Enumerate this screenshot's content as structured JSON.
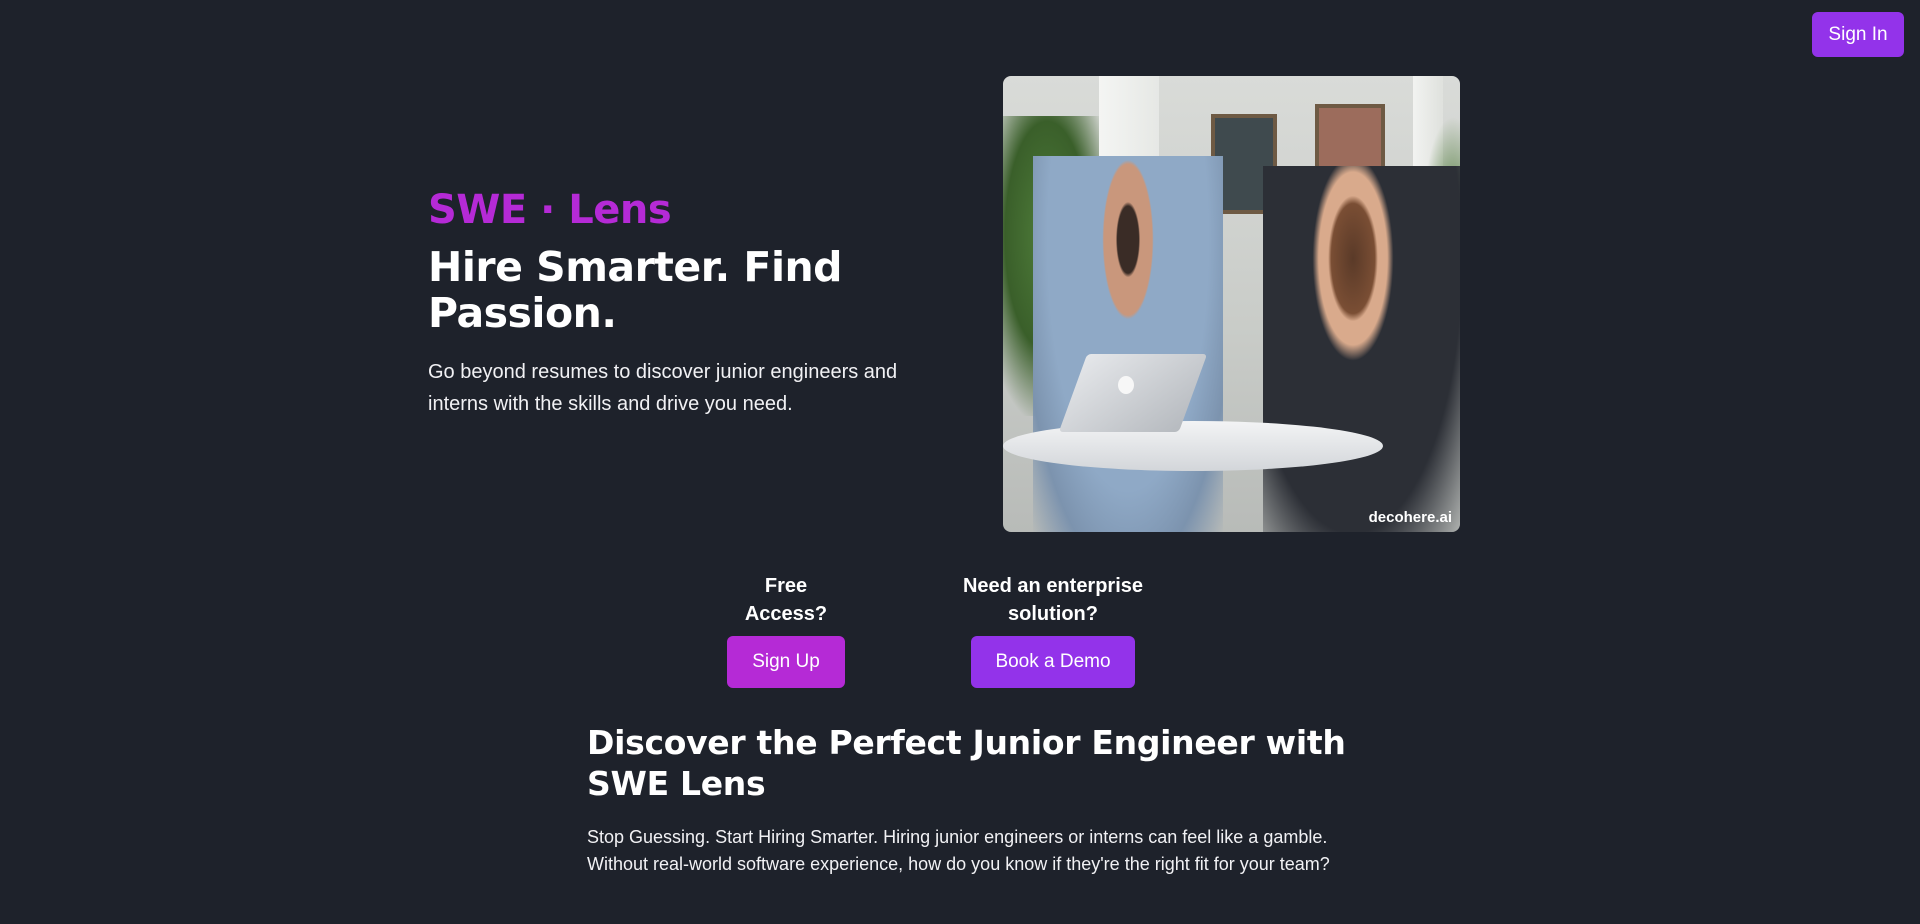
{
  "header": {
    "sign_in_label": "Sign In"
  },
  "hero": {
    "brand": "SWE · Lens",
    "headline": "Hire Smarter. Find Passion.",
    "subline": "Go beyond resumes to discover junior engineers and interns with the skills and drive you need.",
    "image_watermark": "decohere.ai"
  },
  "cta": {
    "free": {
      "label": "Free Access?",
      "button": "Sign Up"
    },
    "enterprise": {
      "label": "Need an enterprise solution?",
      "button": "Book a Demo"
    }
  },
  "discover": {
    "title": "Discover the Perfect Junior Engineer with SWE Lens",
    "body": "Stop Guessing. Start Hiring Smarter. Hiring junior engineers or interns can feel like a gamble. Without real-world software experience, how do you know if they're the right fit for your team?"
  },
  "colors": {
    "background": "#1e222b",
    "brand_magenta": "#b52ad6",
    "button_purple": "#9333ea"
  }
}
